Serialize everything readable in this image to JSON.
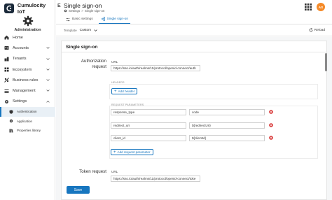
{
  "brand": {
    "name": "Cumulocity IoT",
    "icon": "cumulocity-logo"
  },
  "app": {
    "name": "Administration",
    "icon": "gear-icon"
  },
  "nav": {
    "items": [
      {
        "label": "Home",
        "icon": "home-icon"
      },
      {
        "label": "Accounts",
        "icon": "accounts-icon"
      },
      {
        "label": "Tenants",
        "icon": "tenants-icon"
      },
      {
        "label": "Ecosystem",
        "icon": "ecosystem-icon"
      },
      {
        "label": "Business rules",
        "icon": "business-rules-icon"
      },
      {
        "label": "Management",
        "icon": "management-icon"
      },
      {
        "label": "Settings",
        "icon": "settings-icon"
      }
    ],
    "subitems": [
      {
        "label": "Authentication",
        "icon": "shield-icon",
        "active": true
      },
      {
        "label": "Application",
        "icon": "application-icon"
      },
      {
        "label": "Properties library",
        "icon": "library-icon"
      }
    ]
  },
  "header": {
    "title": "Single sign-on",
    "breadcrumb": [
      "Settings",
      "Single sign-on"
    ],
    "avatar_initials": "AS"
  },
  "tabs": [
    {
      "label": "Basic settings",
      "icon": "sliders-icon"
    },
    {
      "label": "Single sign-on",
      "icon": "login-icon",
      "active": true
    }
  ],
  "actionbar": {
    "template_label": "Template",
    "template_value": "Custom",
    "reload_label": "Reload"
  },
  "form": {
    "title": "Single sign-on",
    "authorization_request": {
      "section_label": "Authorization\nrequest",
      "url_label": "URL",
      "url_value": "https://sso.io/auth/realms/11/protocol/openid-connect/auth",
      "headers_title": "HEADERS",
      "add_header_label": "Add header",
      "params_title": "REQUEST PARAMETERS",
      "params": [
        {
          "key": "response_type",
          "value": "code"
        },
        {
          "key": "redirect_uri",
          "value": "${redirectUri}"
        },
        {
          "key": "client_id",
          "value": "${clientId}"
        }
      ],
      "add_param_label": "Add request parameter"
    },
    "token_request": {
      "section_label": "Token request",
      "url_label": "URL",
      "url_value": "https://sso.io/auth/realms/11/protocol/openid-connect/toke"
    },
    "save_label": "Save"
  },
  "colors": {
    "accent": "#1776bf",
    "danger": "#d62c2c",
    "avatar": "#f58a28"
  }
}
